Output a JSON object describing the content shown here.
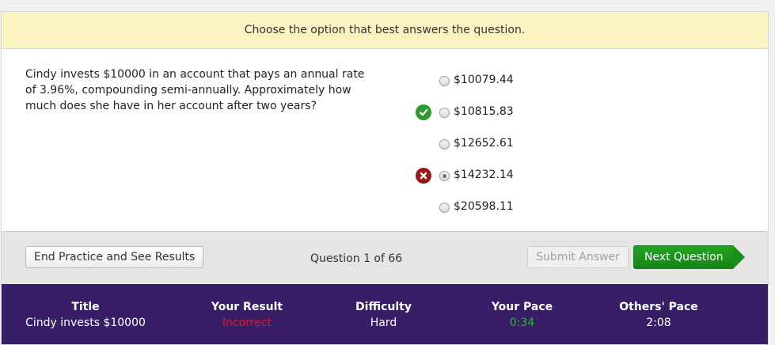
{
  "banner": {
    "text": "Choose the option that best answers the question."
  },
  "question": {
    "text": "Cindy invests $10000 in an account that pays an annual rate of 3.96%, compounding semi-annually. Approximately how much does she have in her account after two years?"
  },
  "choices": [
    {
      "label": "$10079.44",
      "selected": false,
      "mark": ""
    },
    {
      "label": "$10815.83",
      "selected": false,
      "mark": "check-icon"
    },
    {
      "label": "$12652.61",
      "selected": false,
      "mark": ""
    },
    {
      "label": "$14232.14",
      "selected": true,
      "mark": "x-icon"
    },
    {
      "label": "$20598.11",
      "selected": false,
      "mark": ""
    }
  ],
  "toolbar": {
    "end_label": "End Practice and See Results",
    "counter": "Question 1 of 66",
    "submit_label": "Submit Answer",
    "next_label": "Next Question"
  },
  "footer": {
    "title_label": "Title",
    "title_value": "Cindy invests $10000",
    "result_label": "Your Result",
    "result_value": "Incorrect",
    "difficulty_label": "Difficulty",
    "difficulty_value": "Hard",
    "pace_label": "Your Pace",
    "pace_value": "0:34",
    "others_label": "Others' Pace",
    "others_value": "2:08"
  },
  "colors": {
    "banner_bg": "#fcf3c2",
    "footer_bg": "#371e66",
    "next_button": "#1a8f1a",
    "correct": "#2e9a2e",
    "incorrect": "#9b1717",
    "result_text": "#e8141e",
    "pace_text": "#2fb82f"
  }
}
